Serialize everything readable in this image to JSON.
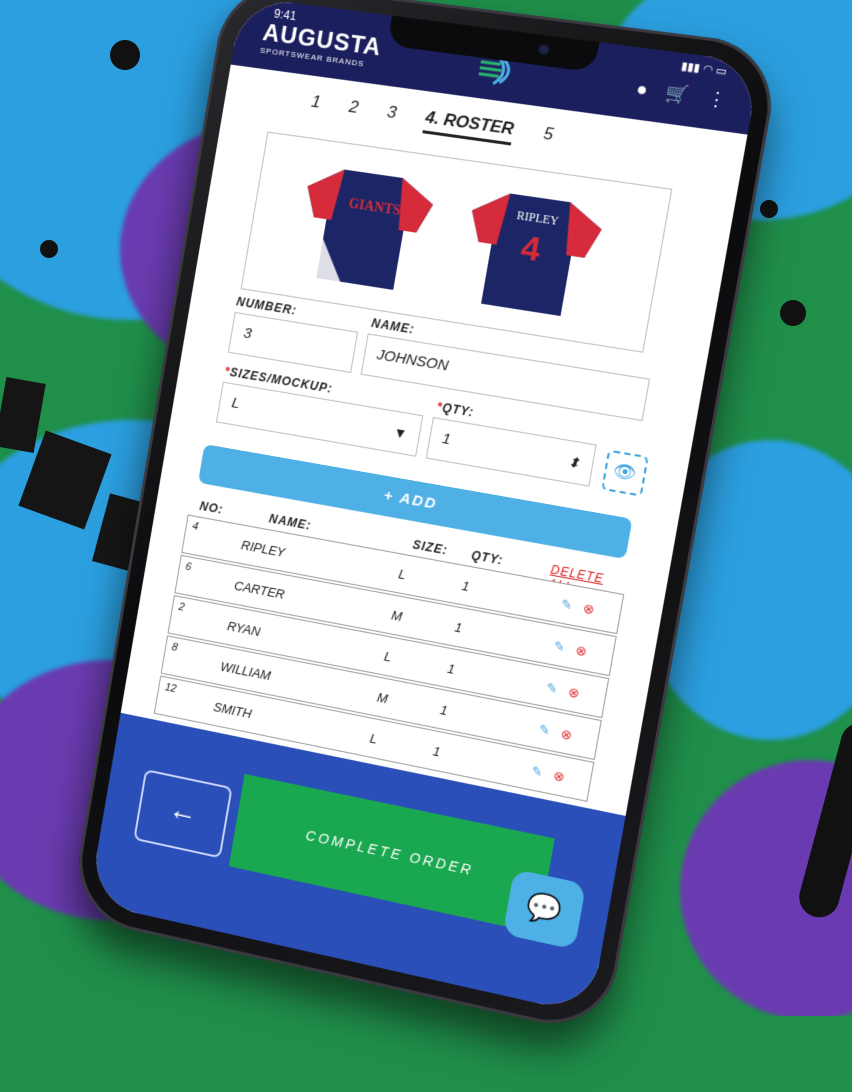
{
  "status": {
    "time": "9:41"
  },
  "header": {
    "brand": "AUGUSTA",
    "brand_sub": "SPORTSWEAR BRANDS",
    "icons": [
      "user-icon",
      "cart-icon",
      "more-icon"
    ]
  },
  "steps": [
    {
      "label": "1"
    },
    {
      "label": "2"
    },
    {
      "label": "3"
    },
    {
      "label": "4. ROSTER"
    },
    {
      "label": "5"
    }
  ],
  "preview": {
    "front_text": "GIANTS",
    "back_name": "RIPLEY",
    "back_number": "4"
  },
  "form": {
    "number_label": "NUMBER:",
    "number_value": "3",
    "name_label": "NAME:",
    "name_value": "JOHNSON",
    "size_label": "SIZES/MOCKUP:",
    "size_value": "L",
    "qty_label": "QTY:",
    "qty_value": "1",
    "add_label": "+ ADD"
  },
  "table": {
    "headers": {
      "no": "NO:",
      "name": "NAME:",
      "size": "SIZE:",
      "qty": "QTY:",
      "delete_all": "DELETE ALL"
    },
    "rows": [
      {
        "no": "4",
        "name": "RIPLEY",
        "size": "L",
        "qty": "1"
      },
      {
        "no": "6",
        "name": "CARTER",
        "size": "M",
        "qty": "1"
      },
      {
        "no": "2",
        "name": "RYAN",
        "size": "L",
        "qty": "1"
      },
      {
        "no": "8",
        "name": "WILLIAM",
        "size": "M",
        "qty": "1"
      },
      {
        "no": "12",
        "name": "SMITH",
        "size": "L",
        "qty": "1"
      }
    ]
  },
  "footer": {
    "back_icon": "←",
    "complete_label": "COMPLETE ORDER",
    "chat_icon": "chat-icon"
  },
  "colors": {
    "header": "#1c1f5e",
    "accent": "#4fb0e6",
    "complete": "#19a84f",
    "footer": "#2a4fb8",
    "danger": "#e02828"
  }
}
